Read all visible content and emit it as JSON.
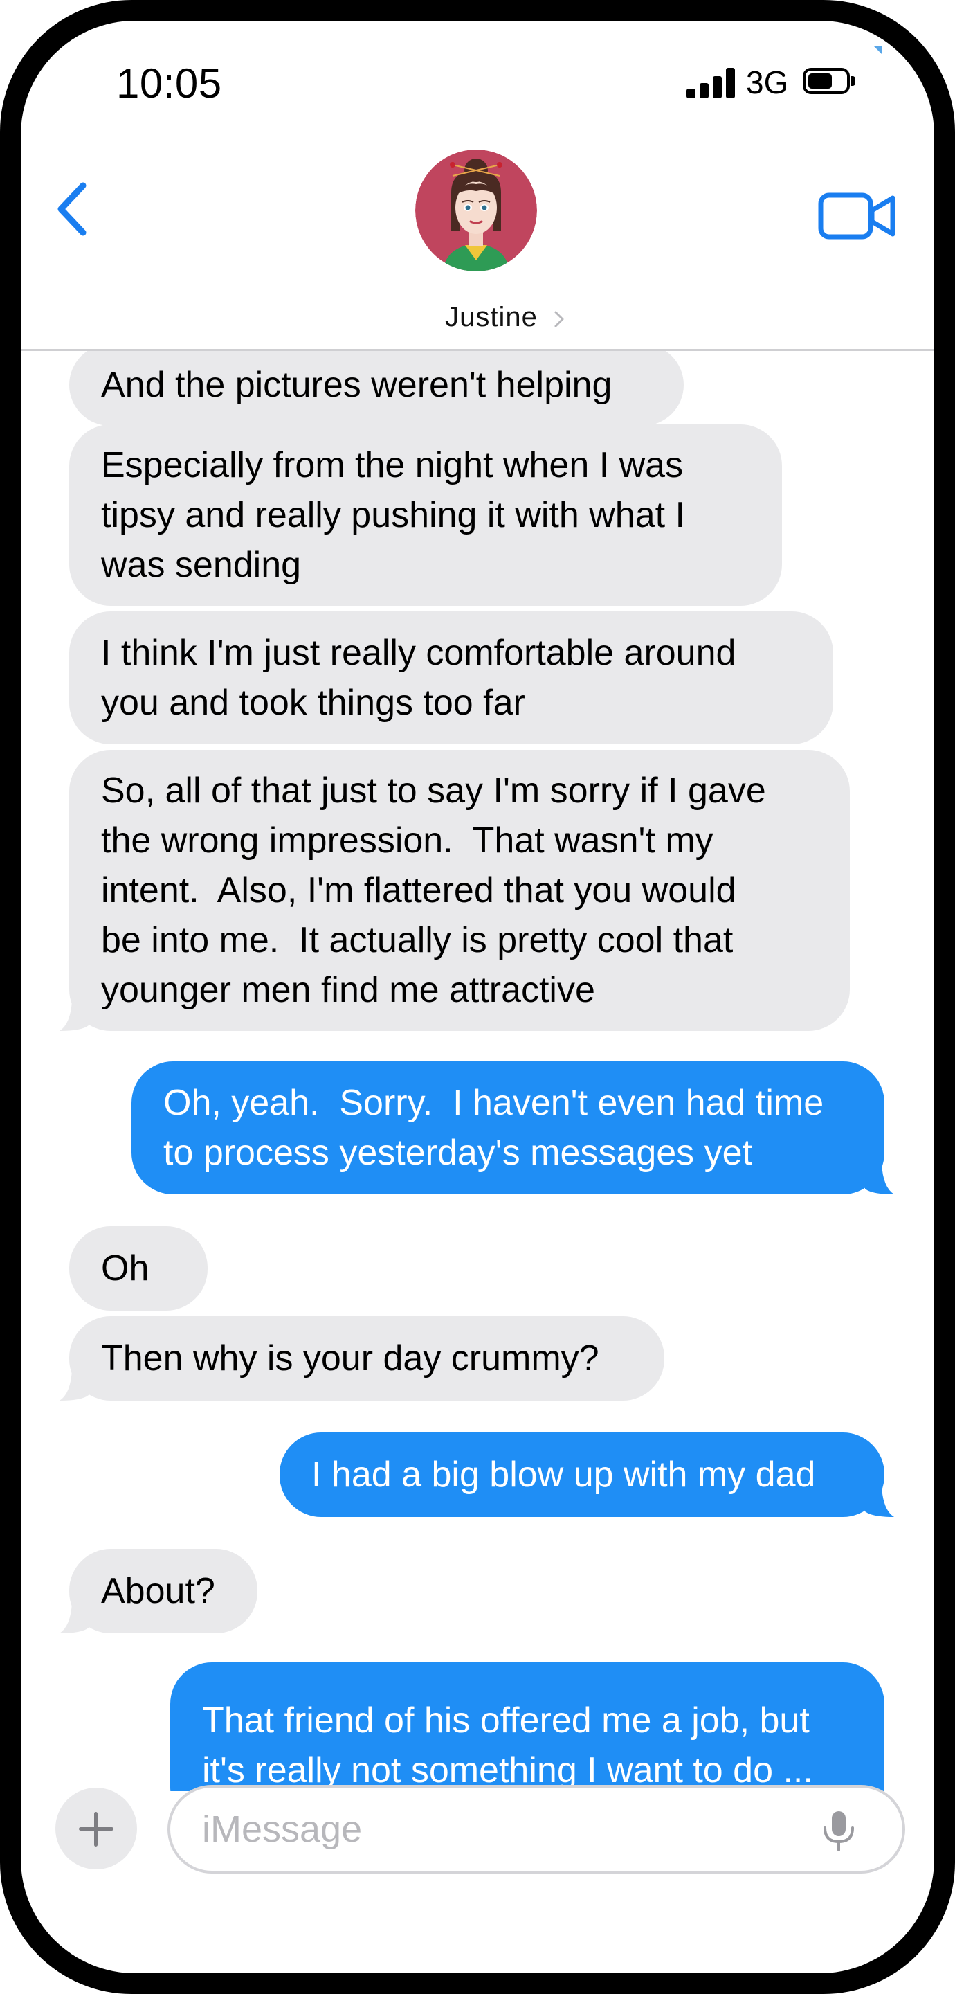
{
  "status_bar": {
    "time": "10:05",
    "network": "3G"
  },
  "header": {
    "contact_name": "Justine"
  },
  "messages": [
    {
      "from": "them",
      "text": "And the pictures weren't helping"
    },
    {
      "from": "them",
      "text": "Especially from the night when I was\ntipsy and really pushing it with what I\nwas sending"
    },
    {
      "from": "them",
      "text": "I think I'm just really comfortable around\nyou and took things too far"
    },
    {
      "from": "them",
      "text": "So, all of that just to say I'm sorry if I gave\nthe wrong impression.  That wasn't my\nintent.  Also, I'm flattered that you would\nbe into me.  It actually is pretty cool that\nyounger men find me attractive"
    },
    {
      "from": "me",
      "text": "Oh, yeah.  Sorry.  I haven't even had time\nto process yesterday's messages yet"
    },
    {
      "from": "them",
      "text": "Oh"
    },
    {
      "from": "them",
      "text": "Then why is your day crummy?"
    },
    {
      "from": "me",
      "text": "I had a big blow up with my dad"
    },
    {
      "from": "them",
      "text": "About?"
    },
    {
      "from": "me",
      "text": "That friend of his offered me a job, but\nit's really not something I want to do ..."
    }
  ],
  "composer": {
    "placeholder": "iMessage"
  },
  "colors": {
    "sent_bubble": "#1f8ef5",
    "received_bubble": "#e9e9eb",
    "accent": "#1a7ef0"
  },
  "icons": [
    "back-chevron-icon",
    "video-camera-icon",
    "plus-icon",
    "microphone-icon"
  ]
}
